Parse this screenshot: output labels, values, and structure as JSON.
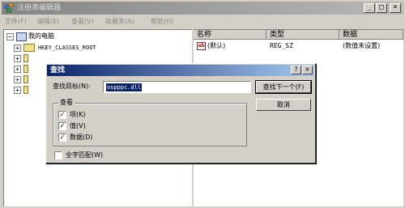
{
  "window": {
    "title": "注册表编辑器",
    "minimize": "_",
    "maximize": "□",
    "close": "×"
  },
  "menu": [
    {
      "label": "文件(F)"
    },
    {
      "label": "编辑(E)"
    },
    {
      "label": "查看(V)"
    },
    {
      "label": "收藏夹(A)"
    },
    {
      "label": "帮助(H)"
    }
  ],
  "tree": {
    "root": {
      "label": "我的电脑",
      "expander": "−"
    },
    "children": [
      {
        "label": "HKEY_CLASSES_ROOT",
        "expander": "+"
      }
    ],
    "collapsed_marker": "+"
  },
  "list": {
    "columns": [
      {
        "label": "名称"
      },
      {
        "label": "类型"
      },
      {
        "label": "数据"
      }
    ],
    "rows": [
      {
        "icon": "ab",
        "name": "(默认)",
        "type": "REG_SZ",
        "data": "(数值未设置)"
      }
    ]
  },
  "find_dialog": {
    "title": "查找",
    "help_button": "?",
    "close_button": "×",
    "find_what_label": "查找目标(N):",
    "find_what_value": "ospppc.dll",
    "find_next_button": "查找下一个(F)",
    "cancel_button": "取消",
    "look_at_group": "查看",
    "options": [
      {
        "label": "项(K)",
        "checked": true
      },
      {
        "label": "值(V)",
        "checked": true
      },
      {
        "label": "数据(D)",
        "checked": true
      }
    ],
    "match_whole_label": "全字匹配(W)",
    "match_whole_checked": false,
    "check_mark": "✓"
  },
  "colors": {
    "dialog_title_start": "#0a246a",
    "dialog_title_end": "#a6caf0",
    "inactive_title_start": "#848484",
    "selection": "#0a246a",
    "face": "#d4d0c8"
  }
}
